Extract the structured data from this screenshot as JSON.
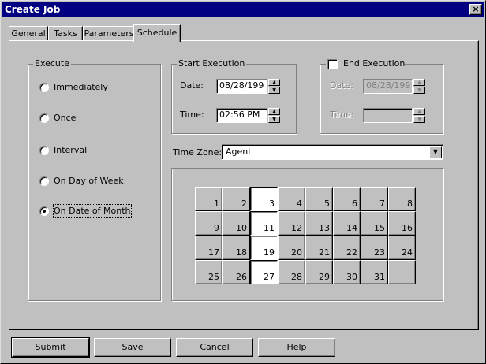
{
  "window": {
    "title": "Create Job",
    "close_glyph": "×"
  },
  "tabs": [
    "General",
    "Tasks",
    "Parameters",
    "Schedule"
  ],
  "execute": {
    "label": "Execute",
    "options": [
      "Immediately",
      "Once",
      "Interval",
      "On Day of Week",
      "On Date of Month"
    ],
    "selected": "On Date of Month"
  },
  "start": {
    "label": "Start Execution",
    "date_label": "Date:",
    "date_value": "08/28/199",
    "time_label": "Time:",
    "time_value": "02:56 PM"
  },
  "end": {
    "label": "End Execution",
    "checked": false,
    "date_label": "Date:",
    "date_value": "08/28/199",
    "time_label": "Time:",
    "time_value": ""
  },
  "timezone": {
    "label": "Time Zone:",
    "value": "Agent"
  },
  "calendar": {
    "days": [
      "1",
      "2",
      "3",
      "4",
      "5",
      "6",
      "7",
      "8",
      "9",
      "10",
      "11",
      "12",
      "13",
      "14",
      "15",
      "16",
      "17",
      "18",
      "19",
      "20",
      "21",
      "22",
      "23",
      "24",
      "25",
      "26",
      "27",
      "28",
      "29",
      "30",
      "31",
      ""
    ],
    "selected": [
      "3",
      "11",
      "19",
      "27"
    ]
  },
  "buttons": {
    "submit": "Submit",
    "save": "Save",
    "cancel": "Cancel",
    "help": "Help"
  },
  "icons": {
    "spin_up": "▲",
    "spin_down": "▼",
    "dropdown": "▼"
  },
  "colors": {
    "titlebar": "#000080",
    "face": "#c0c0c0"
  }
}
